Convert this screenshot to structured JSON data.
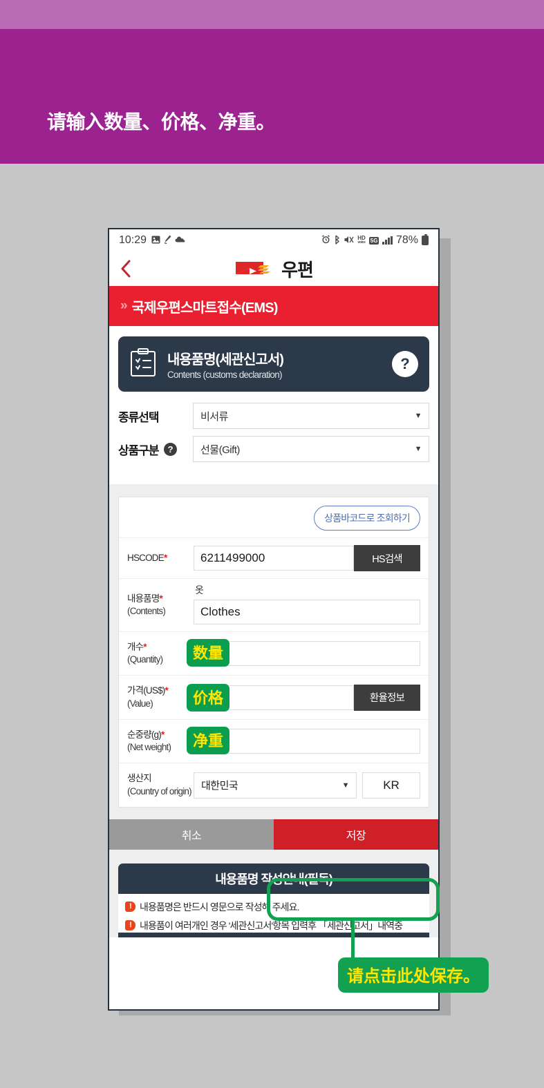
{
  "banner": {
    "instruction": "请输入数量、价格、净重。",
    "bg_color": "#9c2290",
    "strip_color": "#bb6bb4"
  },
  "phone": {
    "statusbar": {
      "time": "10:29",
      "left_icons": [
        "photo-icon",
        "pen-icon",
        "cloud-icon"
      ],
      "right_icons": [
        "alarm-icon",
        "bluetooth-icon",
        "mute-icon",
        "hd-voice-icon",
        "5g-icon",
        "signal-bars-icon"
      ],
      "hd_label": "HD",
      "hd_sub": "voice",
      "network_label": "5G",
      "battery_percent": "78%"
    },
    "appbar": {
      "back_icon": "chevron-left-icon",
      "brand_name": "우편",
      "logo_icon": "korea-post-logo"
    },
    "redbar": {
      "chevron": "»",
      "title": "국제우편스마트접수(EMS)",
      "bg_color": "#e8202f"
    },
    "section_card": {
      "icon": "clipboard-checklist-icon",
      "title_ko": "내용품명(세관신고서)",
      "title_en": "Contents (customs declaration)",
      "help_label": "?",
      "bg_color": "#2b3948"
    },
    "selects": [
      {
        "label": "종류선택",
        "has_help": false,
        "value": "비서류",
        "caret": "▼"
      },
      {
        "label": "상품구분",
        "has_help": true,
        "help_label": "?",
        "value": "선물(Gift)",
        "caret": "▼"
      }
    ],
    "form": {
      "barcode_button": "상품바코드로 조회하기",
      "rows": [
        {
          "label_ko": "HSCODE",
          "label_en": "",
          "required": "*",
          "value": "6211499000",
          "action_button": "HS검색",
          "badge": null
        },
        {
          "label_ko": "내용품명",
          "label_en": "(Contents)",
          "required": "*",
          "sub_ko": "옷",
          "value": "Clothes",
          "action_button": null,
          "badge": null
        },
        {
          "label_ko": "개수",
          "label_en": "(Quantity)",
          "required": "*",
          "value": "",
          "action_button": null,
          "badge": "数量"
        },
        {
          "label_ko": "가격(US$)",
          "label_en": "(Value)",
          "required": "*",
          "value": "",
          "action_button": "환율정보",
          "badge": "价格"
        },
        {
          "label_ko": "순중량(g)",
          "label_en": "(Net weight)",
          "required": "*",
          "value": "",
          "action_button": null,
          "badge": "净重"
        }
      ],
      "country_row": {
        "label_ko": "생산지",
        "label_en": "(Country of origin)",
        "value": "대한민국",
        "caret": "▼",
        "code": "KR"
      }
    },
    "actions": {
      "cancel_label": "취소",
      "save_label": "저장",
      "cancel_color": "#9a9a9a",
      "save_color": "#cf2027"
    },
    "notice": {
      "title": "내용품명 작성안내(필독)",
      "lines": [
        "내용품명은 반드시 영문으로 작성해 주세요.",
        "내용품이 여러개인 경우 '세관신고서'항목 입력후 「세관신고서」내역중"
      ]
    }
  },
  "annotation": {
    "callout_text": "请点击此处保存。",
    "highlight_color": "#12a150",
    "callout_text_color": "#ffe600"
  }
}
